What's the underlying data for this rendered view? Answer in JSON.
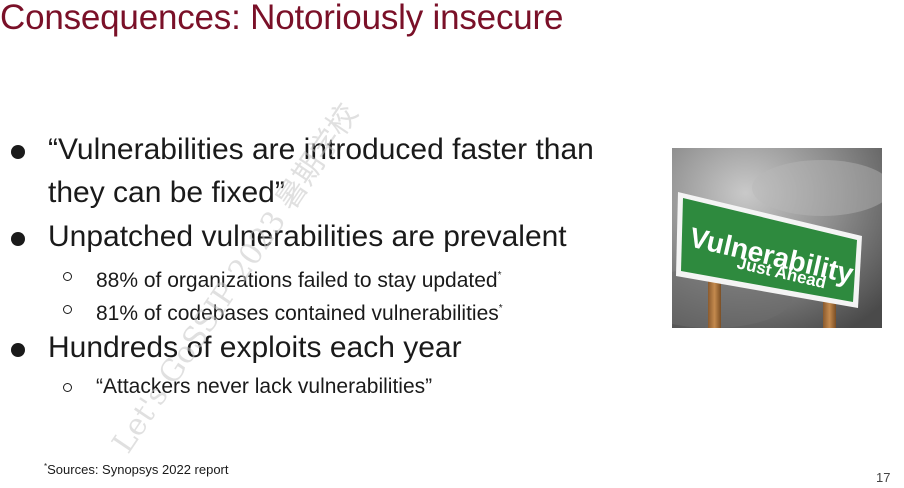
{
  "slide": {
    "title": "Consequences: Notoriously insecure",
    "bullets": [
      {
        "lines": [
          "“Vulnerabilities are introduced faster than",
          "they can be fixed”"
        ]
      },
      {
        "lines": [
          "Unpatched vulnerabilities are prevalent"
        ],
        "sub": [
          {
            "text": "88% of organizations failed to stay updated",
            "mark": "*"
          },
          {
            "text": "81% of codebases contained vulnerabilities",
            "mark": "*"
          }
        ]
      },
      {
        "lines": [
          "Hundreds of exploits each year"
        ],
        "sub": [
          {
            "text": "“Attackers never lack vulnerabilities”"
          }
        ]
      }
    ],
    "footnote": {
      "mark": "*",
      "text": "Sources: Synopsys 2022 report"
    },
    "page_number": "17"
  },
  "image": {
    "sign_title": "Vulnerability",
    "sign_subtitle": "Just Ahead",
    "sign_color": "#2e8a3e"
  },
  "watermark": {
    "text": "Let's GoSSIP 2023 暑期学校"
  },
  "colors": {
    "title": "#7a1028",
    "text": "#1a1a1a"
  }
}
